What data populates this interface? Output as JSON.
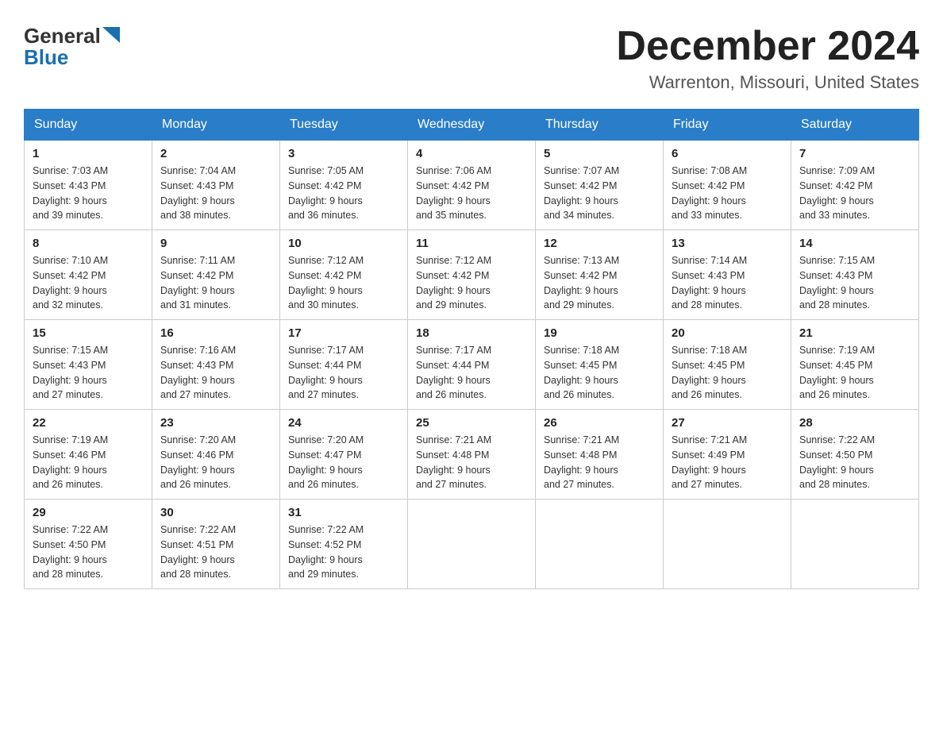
{
  "header": {
    "logo_general": "General",
    "logo_blue": "Blue",
    "month_title": "December 2024",
    "location": "Warrenton, Missouri, United States"
  },
  "weekdays": [
    "Sunday",
    "Monday",
    "Tuesday",
    "Wednesday",
    "Thursday",
    "Friday",
    "Saturday"
  ],
  "weeks": [
    [
      {
        "day": "1",
        "sunrise": "7:03 AM",
        "sunset": "4:43 PM",
        "daylight": "9 hours and 39 minutes."
      },
      {
        "day": "2",
        "sunrise": "7:04 AM",
        "sunset": "4:43 PM",
        "daylight": "9 hours and 38 minutes."
      },
      {
        "day": "3",
        "sunrise": "7:05 AM",
        "sunset": "4:42 PM",
        "daylight": "9 hours and 36 minutes."
      },
      {
        "day": "4",
        "sunrise": "7:06 AM",
        "sunset": "4:42 PM",
        "daylight": "9 hours and 35 minutes."
      },
      {
        "day": "5",
        "sunrise": "7:07 AM",
        "sunset": "4:42 PM",
        "daylight": "9 hours and 34 minutes."
      },
      {
        "day": "6",
        "sunrise": "7:08 AM",
        "sunset": "4:42 PM",
        "daylight": "9 hours and 33 minutes."
      },
      {
        "day": "7",
        "sunrise": "7:09 AM",
        "sunset": "4:42 PM",
        "daylight": "9 hours and 33 minutes."
      }
    ],
    [
      {
        "day": "8",
        "sunrise": "7:10 AM",
        "sunset": "4:42 PM",
        "daylight": "9 hours and 32 minutes."
      },
      {
        "day": "9",
        "sunrise": "7:11 AM",
        "sunset": "4:42 PM",
        "daylight": "9 hours and 31 minutes."
      },
      {
        "day": "10",
        "sunrise": "7:12 AM",
        "sunset": "4:42 PM",
        "daylight": "9 hours and 30 minutes."
      },
      {
        "day": "11",
        "sunrise": "7:12 AM",
        "sunset": "4:42 PM",
        "daylight": "9 hours and 29 minutes."
      },
      {
        "day": "12",
        "sunrise": "7:13 AM",
        "sunset": "4:42 PM",
        "daylight": "9 hours and 29 minutes."
      },
      {
        "day": "13",
        "sunrise": "7:14 AM",
        "sunset": "4:43 PM",
        "daylight": "9 hours and 28 minutes."
      },
      {
        "day": "14",
        "sunrise": "7:15 AM",
        "sunset": "4:43 PM",
        "daylight": "9 hours and 28 minutes."
      }
    ],
    [
      {
        "day": "15",
        "sunrise": "7:15 AM",
        "sunset": "4:43 PM",
        "daylight": "9 hours and 27 minutes."
      },
      {
        "day": "16",
        "sunrise": "7:16 AM",
        "sunset": "4:43 PM",
        "daylight": "9 hours and 27 minutes."
      },
      {
        "day": "17",
        "sunrise": "7:17 AM",
        "sunset": "4:44 PM",
        "daylight": "9 hours and 27 minutes."
      },
      {
        "day": "18",
        "sunrise": "7:17 AM",
        "sunset": "4:44 PM",
        "daylight": "9 hours and 26 minutes."
      },
      {
        "day": "19",
        "sunrise": "7:18 AM",
        "sunset": "4:45 PM",
        "daylight": "9 hours and 26 minutes."
      },
      {
        "day": "20",
        "sunrise": "7:18 AM",
        "sunset": "4:45 PM",
        "daylight": "9 hours and 26 minutes."
      },
      {
        "day": "21",
        "sunrise": "7:19 AM",
        "sunset": "4:45 PM",
        "daylight": "9 hours and 26 minutes."
      }
    ],
    [
      {
        "day": "22",
        "sunrise": "7:19 AM",
        "sunset": "4:46 PM",
        "daylight": "9 hours and 26 minutes."
      },
      {
        "day": "23",
        "sunrise": "7:20 AM",
        "sunset": "4:46 PM",
        "daylight": "9 hours and 26 minutes."
      },
      {
        "day": "24",
        "sunrise": "7:20 AM",
        "sunset": "4:47 PM",
        "daylight": "9 hours and 26 minutes."
      },
      {
        "day": "25",
        "sunrise": "7:21 AM",
        "sunset": "4:48 PM",
        "daylight": "9 hours and 27 minutes."
      },
      {
        "day": "26",
        "sunrise": "7:21 AM",
        "sunset": "4:48 PM",
        "daylight": "9 hours and 27 minutes."
      },
      {
        "day": "27",
        "sunrise": "7:21 AM",
        "sunset": "4:49 PM",
        "daylight": "9 hours and 27 minutes."
      },
      {
        "day": "28",
        "sunrise": "7:22 AM",
        "sunset": "4:50 PM",
        "daylight": "9 hours and 28 minutes."
      }
    ],
    [
      {
        "day": "29",
        "sunrise": "7:22 AM",
        "sunset": "4:50 PM",
        "daylight": "9 hours and 28 minutes."
      },
      {
        "day": "30",
        "sunrise": "7:22 AM",
        "sunset": "4:51 PM",
        "daylight": "9 hours and 28 minutes."
      },
      {
        "day": "31",
        "sunrise": "7:22 AM",
        "sunset": "4:52 PM",
        "daylight": "9 hours and 29 minutes."
      },
      null,
      null,
      null,
      null
    ]
  ]
}
